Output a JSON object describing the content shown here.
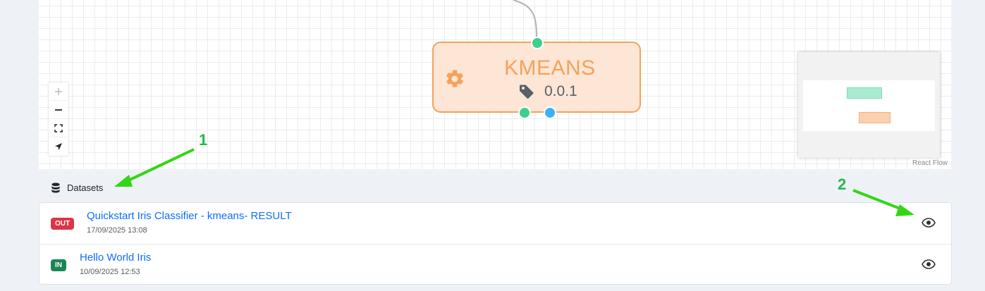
{
  "canvas": {
    "node": {
      "title": "KMEANS",
      "version": "0.0.1",
      "icon": "gear-icon",
      "tag_icon": "tag-icon",
      "border_color": "#f5a15b",
      "fill_color": "#fde6d5"
    },
    "controls": [
      "zoom-in",
      "zoom-out",
      "fit-view",
      "locate"
    ],
    "attribution": "React Flow"
  },
  "datasets": {
    "header": "Datasets",
    "icon": "database-icon",
    "items": [
      {
        "badge": "OUT",
        "name": "Quickstart Iris Classifier - kmeans- RESULT",
        "date": "17/09/2025 13:08",
        "action_icon": "eye-icon"
      },
      {
        "badge": "IN",
        "name": "Hello World Iris",
        "date": "10/09/2025 12:53",
        "action_icon": "eye-icon"
      }
    ]
  },
  "annotations": {
    "label_1": "1",
    "label_2": "2",
    "color": "#27b54a"
  },
  "colors": {
    "out_badge": "#dc3545",
    "in_badge": "#198754",
    "link": "#0d6efd",
    "handle_green": "#3ecf8e",
    "handle_blue": "#3bb2f5"
  }
}
